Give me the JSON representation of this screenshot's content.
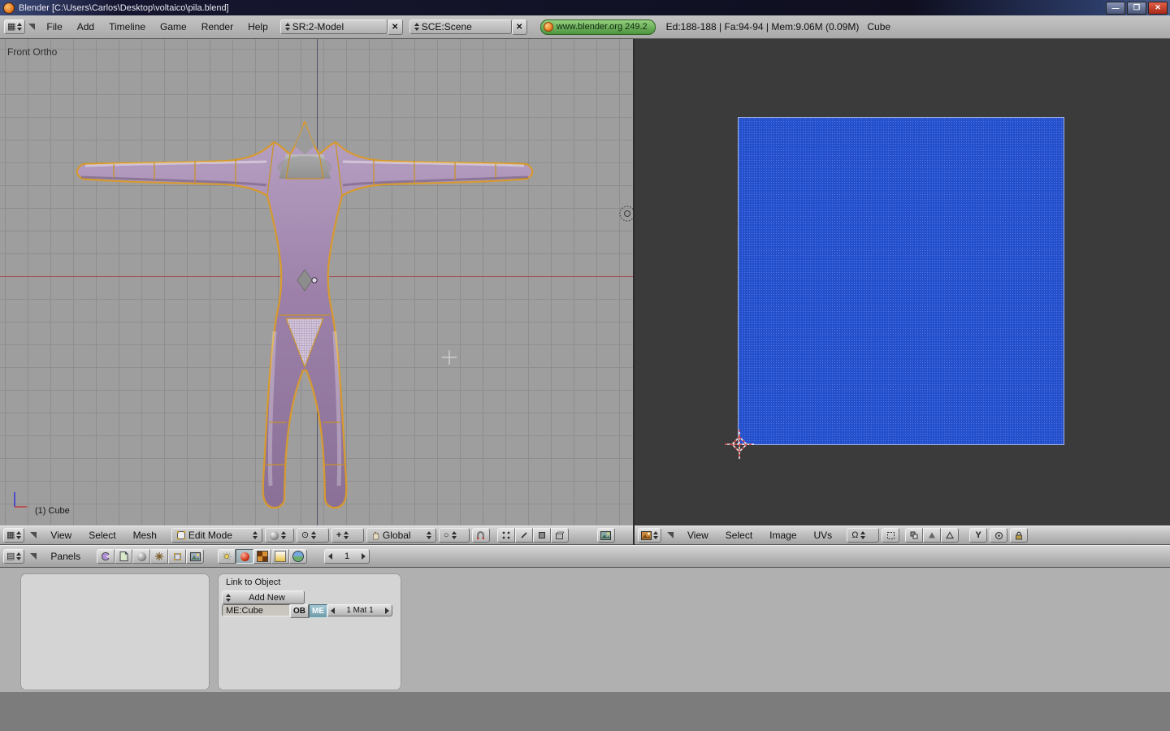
{
  "titlebar": {
    "title": "Blender [C:\\Users\\Carlos\\Desktop\\voltaico\\pila.blend]"
  },
  "icons": {
    "minimize": "—",
    "restore": "❐",
    "close": "✕",
    "delete_x": "✕",
    "omega": "Ω",
    "y_tool": "Y",
    "grid": "▦",
    "buttons_grid": "▤",
    "pivot": "⊙",
    "prop_circle": "○",
    "manip": "+",
    "left": "◀",
    "right": "▶"
  },
  "menubar": {
    "menus": [
      "File",
      "Add",
      "Timeline",
      "Game",
      "Render",
      "Help"
    ],
    "screen": "SR:2-Model",
    "scene": "SCE:Scene",
    "badge": "www.blender.org 249.2",
    "stats": "Ed:188-188 | Fa:94-94 | Mem:9.06M (0.09M)   Cube"
  },
  "viewport3d": {
    "view_label": "Front Ortho",
    "object_label": "(1) Cube",
    "header": {
      "menus": [
        "View",
        "Select",
        "Mesh"
      ],
      "mode": "Edit Mode",
      "orientation": "Global"
    }
  },
  "uv_editor": {
    "header": {
      "menus": [
        "View",
        "Select",
        "Image",
        "UVs"
      ]
    }
  },
  "buttons_window": {
    "header": {
      "panels": "Panels",
      "frame": "1"
    },
    "link_panel": {
      "title": "Link to Object",
      "add_new": "Add New",
      "mesh": "ME:Cube",
      "ob": "OB",
      "me": "ME",
      "mat": "1 Mat 1"
    }
  }
}
